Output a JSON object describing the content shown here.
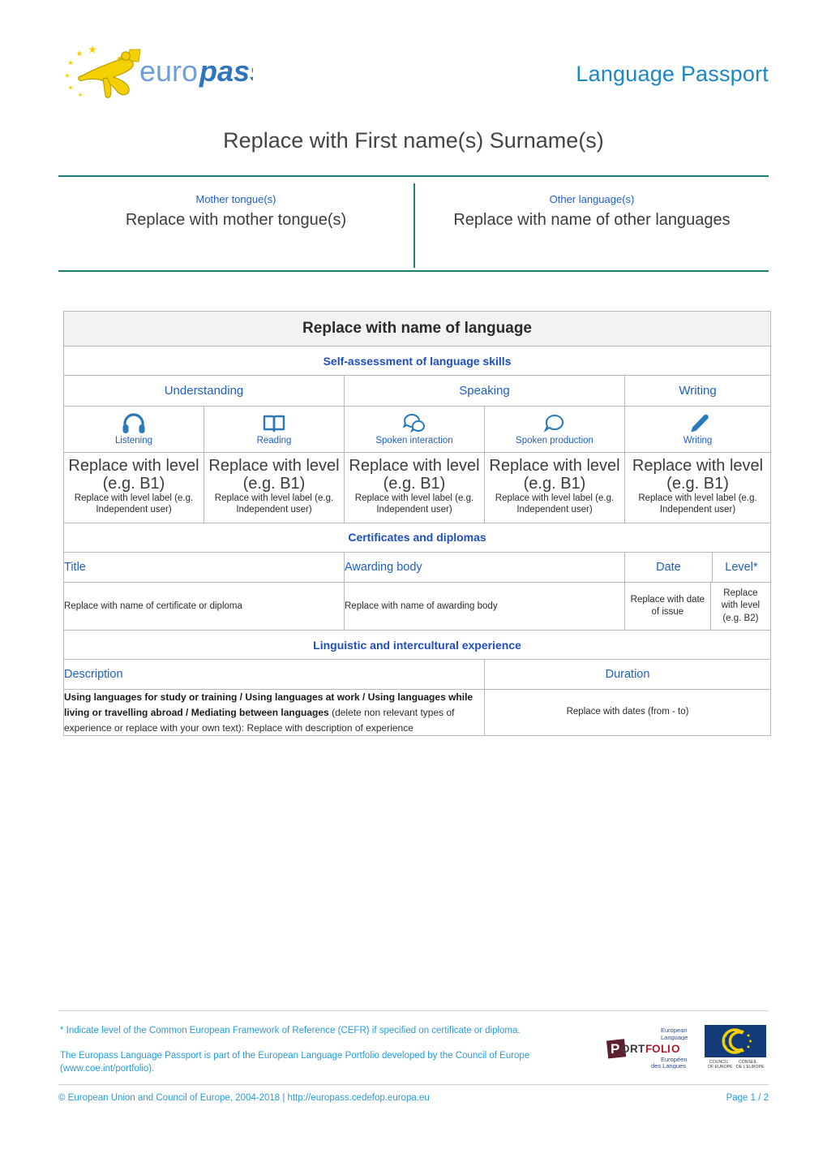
{
  "header": {
    "logo_text_light": "euro",
    "logo_text_bold": "pass",
    "document_type": "Language Passport"
  },
  "person": {
    "name": "Replace with First name(s) Surname(s)"
  },
  "languages": {
    "mother_tongue_label": "Mother tongue(s)",
    "mother_tongue_value": "Replace with mother tongue(s)",
    "other_languages_label": "Other language(s)",
    "other_languages_value": "Replace with name of other languages"
  },
  "language_table": {
    "language_name": "Replace with name of language",
    "self_assessment_title": "Self-assessment of language skills",
    "groups": [
      {
        "label": "Understanding",
        "span": 2
      },
      {
        "label": "Speaking",
        "span": 2
      },
      {
        "label": "Writing",
        "span": 1
      }
    ],
    "skills": [
      {
        "icon": "headphones-icon",
        "label": "Listening"
      },
      {
        "icon": "open-book-icon",
        "label": "Reading"
      },
      {
        "icon": "two-speech-bubbles-icon",
        "label": "Spoken interaction"
      },
      {
        "icon": "speech-bubble-icon",
        "label": "Spoken production"
      },
      {
        "icon": "pencil-icon",
        "label": "Writing"
      }
    ],
    "levels": [
      {
        "main": "Replace with level (e.g. B1)",
        "sub": "Replace with level label (e.g. Independent user)"
      },
      {
        "main": "Replace with level (e.g. B1)",
        "sub": "Replace with level label (e.g. Independent user)"
      },
      {
        "main": "Replace with level (e.g. B1)",
        "sub": "Replace with level label (e.g. Independent user)"
      },
      {
        "main": "Replace with level (e.g. B1)",
        "sub": "Replace with level label (e.g. Independent user)"
      },
      {
        "main": "Replace with level (e.g. B1)",
        "sub": "Replace with level label (e.g. Independent user)"
      }
    ],
    "certificates": {
      "title": "Certificates and diplomas",
      "headers": [
        "Title",
        "Awarding body",
        "Date",
        "Level*"
      ],
      "rows": [
        {
          "title": "Replace with name of certificate or diploma",
          "awarding_body": "Replace with name of awarding body",
          "date": "Replace with date of issue",
          "level": "Replace with level (e.g. B2)"
        }
      ]
    },
    "experience": {
      "title": "Linguistic and intercultural experience",
      "headers": [
        "Description",
        "Duration"
      ],
      "rows": [
        {
          "description_bold": "Using languages for study or training / Using languages at work / Using languages while living or travelling abroad / Mediating between languages",
          "description_rest": " (delete non relevant types of experience or replace with your own text): Replace with description of experience",
          "duration": "Replace with dates (from - to)"
        }
      ]
    }
  },
  "footer": {
    "note_cefr": "* Indicate level of the Common European Framework of Reference (CEFR) if specified on certificate or diploma.",
    "note_portfolio": "The Europass Language Passport is part of the European Language Portfolio developed by the Council of Europe (www.coe.int/portfolio).",
    "portfolio_logo": {
      "line_top_1": "European",
      "line_top_2": "Language",
      "word": "PORTFOLIO",
      "line_bottom_1": "Européen",
      "line_bottom_2": "des Langues"
    },
    "coe_logo": {
      "left_line_1": "COUNCIL",
      "left_line_2": "OF EUROPE",
      "right_line_1": "CONSEIL",
      "right_line_2": "DE L'EUROPE"
    },
    "copyright": "© European Union and Council of Europe, 2004-2018 | http://europass.cedefop.europa.eu",
    "page_number": "Page 1 / 2"
  },
  "colors": {
    "europass_blue": "#1b87c4",
    "label_blue": "#1f5fbe",
    "teal_rule": "#1f7f77",
    "header_gray": "#f2f2f2",
    "footer_blue": "#2a9bd4",
    "logo_gold": "#f4d000"
  }
}
